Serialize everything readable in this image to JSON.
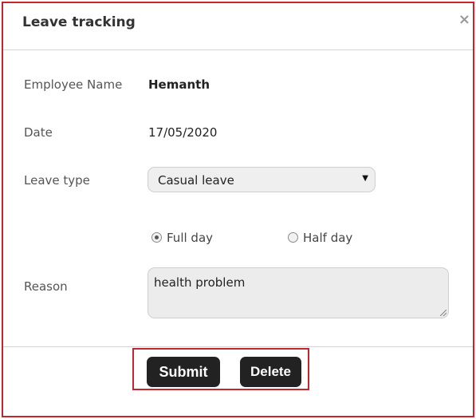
{
  "dialog": {
    "title": "Leave tracking",
    "close_icon": "×"
  },
  "form": {
    "employee_name_label": "Employee Name",
    "employee_name_value": "Hemanth",
    "date_label": "Date",
    "date_value": "17/05/2020",
    "leave_type_label": "Leave type",
    "leave_type_value": "Casual leave",
    "leave_type_arrow": "▼",
    "duration_options": [
      {
        "label": "Full day",
        "checked": true
      },
      {
        "label": "Half day",
        "checked": false
      }
    ],
    "reason_label": "Reason",
    "reason_value": "health problem"
  },
  "actions": {
    "submit_label": "Submit",
    "delete_label": "Delete"
  },
  "colors": {
    "highlight_border": "#c4262e",
    "button_bg": "#222222",
    "button_text": "#ffffff"
  }
}
